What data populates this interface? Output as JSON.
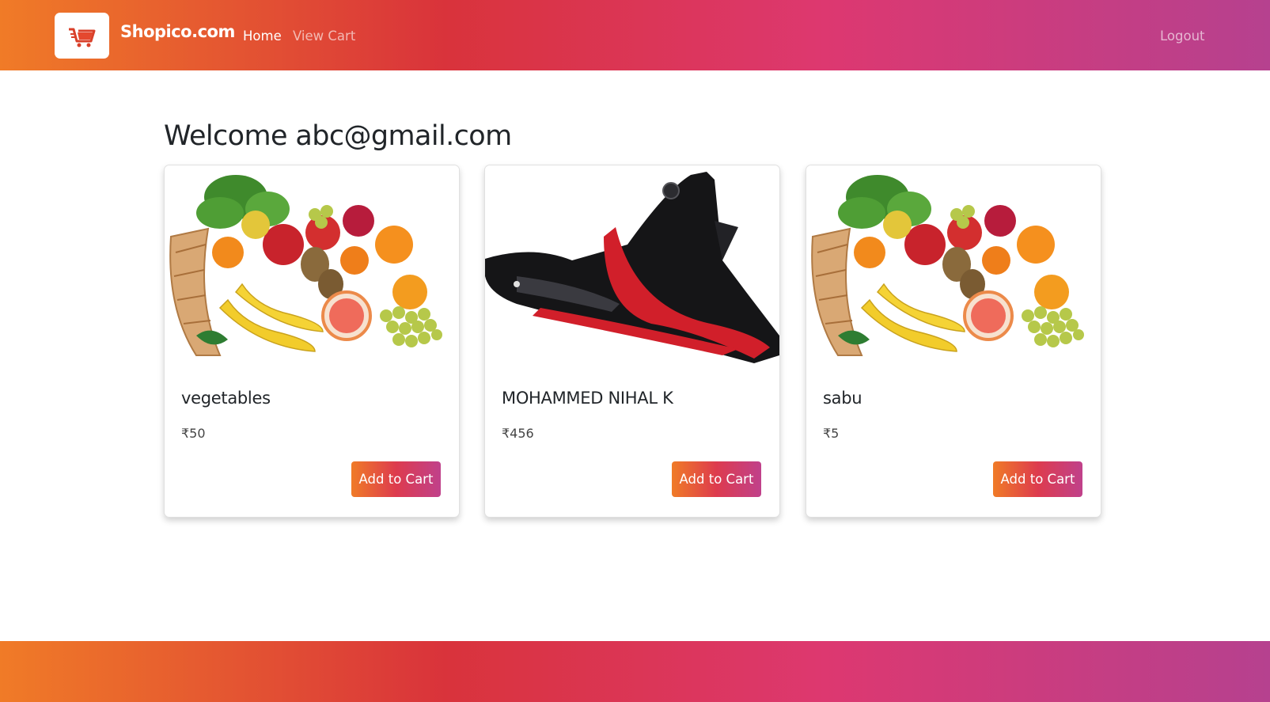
{
  "navbar": {
    "brand": "Shopico.com",
    "logo_icon": "shopping-cart-icon",
    "links": [
      {
        "label": "Home",
        "active": true
      },
      {
        "label": "View Cart",
        "active": false
      }
    ],
    "logout_label": "Logout"
  },
  "main": {
    "welcome_text": "Welcome abc@gmail.com",
    "products": [
      {
        "name": "vegetables",
        "price": "₹50",
        "image": "fruit-basket-image",
        "button_label": "Add to Cart"
      },
      {
        "name": "MOHAMMED NIHAL K",
        "price": "₹456",
        "image": "motorcycle-fairing-image",
        "button_label": "Add to Cart"
      },
      {
        "name": "sabu",
        "price": "₹5",
        "image": "fruit-basket-image",
        "button_label": "Add to Cart"
      }
    ]
  },
  "colors": {
    "gradient_start": "#f07b27",
    "gradient_mid": "#d9333b",
    "gradient_pink": "#dd3870",
    "gradient_end": "#b6418f"
  }
}
